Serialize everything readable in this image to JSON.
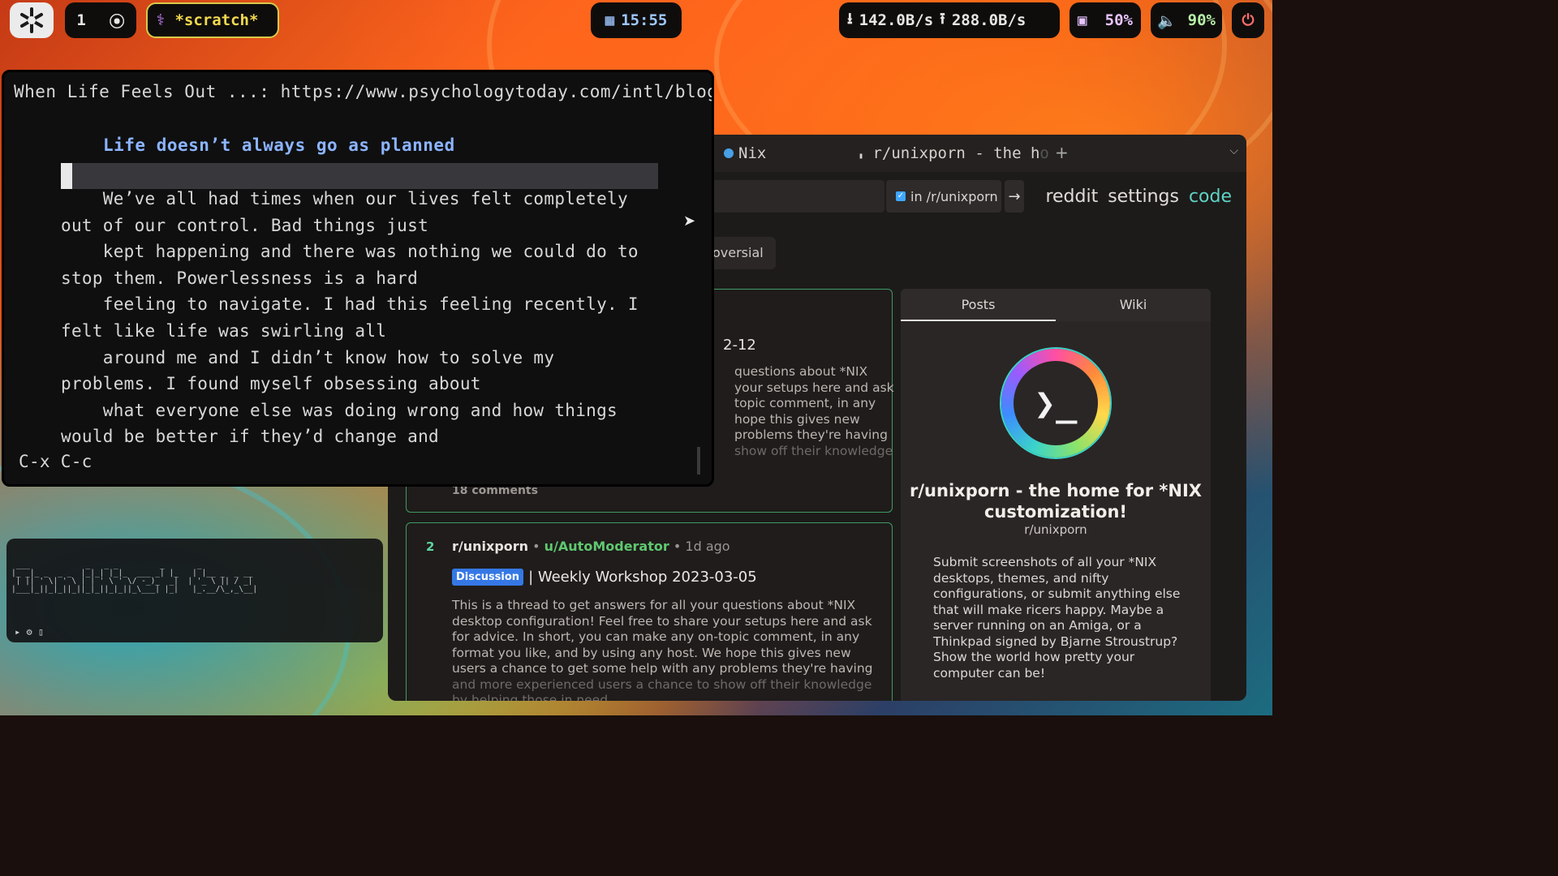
{
  "topbar": {
    "workspace_number": "1",
    "scratch_label": "*scratch*",
    "clock": "15:55",
    "net_down": "142.0B/s",
    "net_up": "288.0B/s",
    "cpu": "50%",
    "volume": "90%"
  },
  "emacs": {
    "title": "When Life Feels Out ...: https://www.psychologytoday.com/intl/blog",
    "heading": "Life doesn’t always go as planned",
    "body": "    We’ve all had times when our lives felt completely\nout of our control. Bad things just\n    kept happening and there was nothing we could do to\nstop them. Powerlessness is a hard\n    feeling to navigate. I had this feeling recently. I\nfelt like life was swirling all\n    around me and I didn’t know how to solve my\nproblems. I found myself obsessing about\n    what everyone else was doing wrong and how things\nwould be better if they’d change and",
    "minibuffer": "C-x C-c"
  },
  "ascii_terminal": {
    "art": " ___            _   _ _         _       _\n|_ _|_ _  _ _  |_|_| |_|_  ___ _| |_   | |__ _  _ __\n | || ' \\| ' \\ | | ' \\ ' \\/ -_)_  _|  | '_ \\ || / _|\n|___|_||_|_||_||_|_||_|_||_\\___| |_|   |_.__/\\_,_\\__|",
    "prompt": "▸ ⚙ ▯"
  },
  "browser": {
    "tabs": [
      {
        "label": "Nix"
      },
      {
        "label": "r/unixporn - the h"
      }
    ],
    "tab_fade": "o",
    "in_subreddit": "in /r/unixporn",
    "links": [
      "reddit",
      "settings",
      "code"
    ],
    "sort_partial": "oversial",
    "post1": {
      "date_partial": "2-12",
      "excerpt": [
        "questions about *NIX",
        "your setups here and ask",
        "topic comment, in any",
        "hope this gives new",
        "problems they're having",
        "show off their knowledge"
      ],
      "comments": "18 comments"
    },
    "post2": {
      "rank": "2",
      "subreddit": "r/unixporn",
      "user": "u/AutoModerator",
      "age": "1d ago",
      "flair": "Discussion",
      "title": "| Weekly Workshop 2023-03-05",
      "text": "This is a thread to get answers for all your questions about *NIX desktop configuration! Feel free to share your setups here and ask for advice. In short, you can make any on-topic comment, in any format you like, and by using any host. We hope this gives new users a chance to get some help with any problems they're having",
      "text_faint": "and more experienced users a chance to show off their knowledge by helping those in need."
    },
    "sidebar": {
      "tabs": [
        "Posts",
        "Wiki"
      ],
      "title": "r/unixporn - the home for *NIX customization!",
      "sub": "r/unixporn",
      "description": "Submit screenshots of all your *NIX desktops, themes, and nifty configurations, or submit anything else that will make ricers happy. Maybe a server running on an Amiga, or a Thinkpad signed by Bjarne Stroustrup? Show the world how pretty your computer can be!"
    }
  }
}
